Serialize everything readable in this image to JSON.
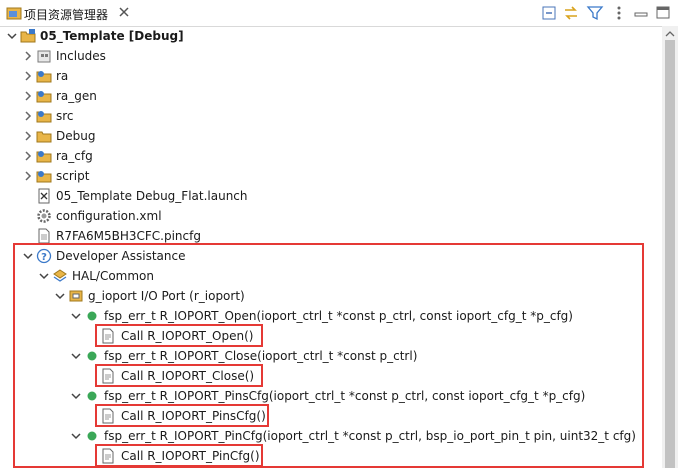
{
  "tab": {
    "title": "项目资源管理器"
  },
  "toolbar": [
    {
      "name": "collapse-all-icon"
    },
    {
      "name": "link-with-editor-icon"
    },
    {
      "name": "filter-icon"
    },
    {
      "name": "view-menu-icon"
    },
    {
      "name": "minimize-icon"
    },
    {
      "name": "maximize-icon"
    }
  ],
  "tree": {
    "project": "05_Template [Debug]",
    "items": [
      "Includes",
      "ra",
      "ra_gen",
      "src",
      "Debug",
      "ra_cfg",
      "script",
      "05_Template Debug_Flat.launch",
      "configuration.xml",
      "R7FA6M5BH3CFC.pincfg"
    ],
    "developer_assistance": "Developer Assistance",
    "hal_common": "HAL/Common",
    "ioport": "g_ioport I/O Port (r_ioport)",
    "functions": [
      {
        "signature": "fsp_err_t R_IOPORT_Open(ioport_ctrl_t *const p_ctrl, const ioport_cfg_t *p_cfg)",
        "call": "Call R_IOPORT_Open()"
      },
      {
        "signature": "fsp_err_t R_IOPORT_Close(ioport_ctrl_t *const p_ctrl)",
        "call": "Call R_IOPORT_Close()"
      },
      {
        "signature": "fsp_err_t R_IOPORT_PinsCfg(ioport_ctrl_t *const p_ctrl, const ioport_cfg_t *p_cfg)",
        "call": "Call R_IOPORT_PinsCfg()"
      },
      {
        "signature": "fsp_err_t R_IOPORT_PinCfg(ioport_ctrl_t *const p_ctrl, bsp_io_port_pin_t pin, uint32_t cfg)",
        "call": "Call R_IOPORT_PinCfg()"
      }
    ]
  },
  "colors": {
    "annotation": "#e53935",
    "folder": "#e8b548",
    "green_dot": "#3aa757"
  }
}
